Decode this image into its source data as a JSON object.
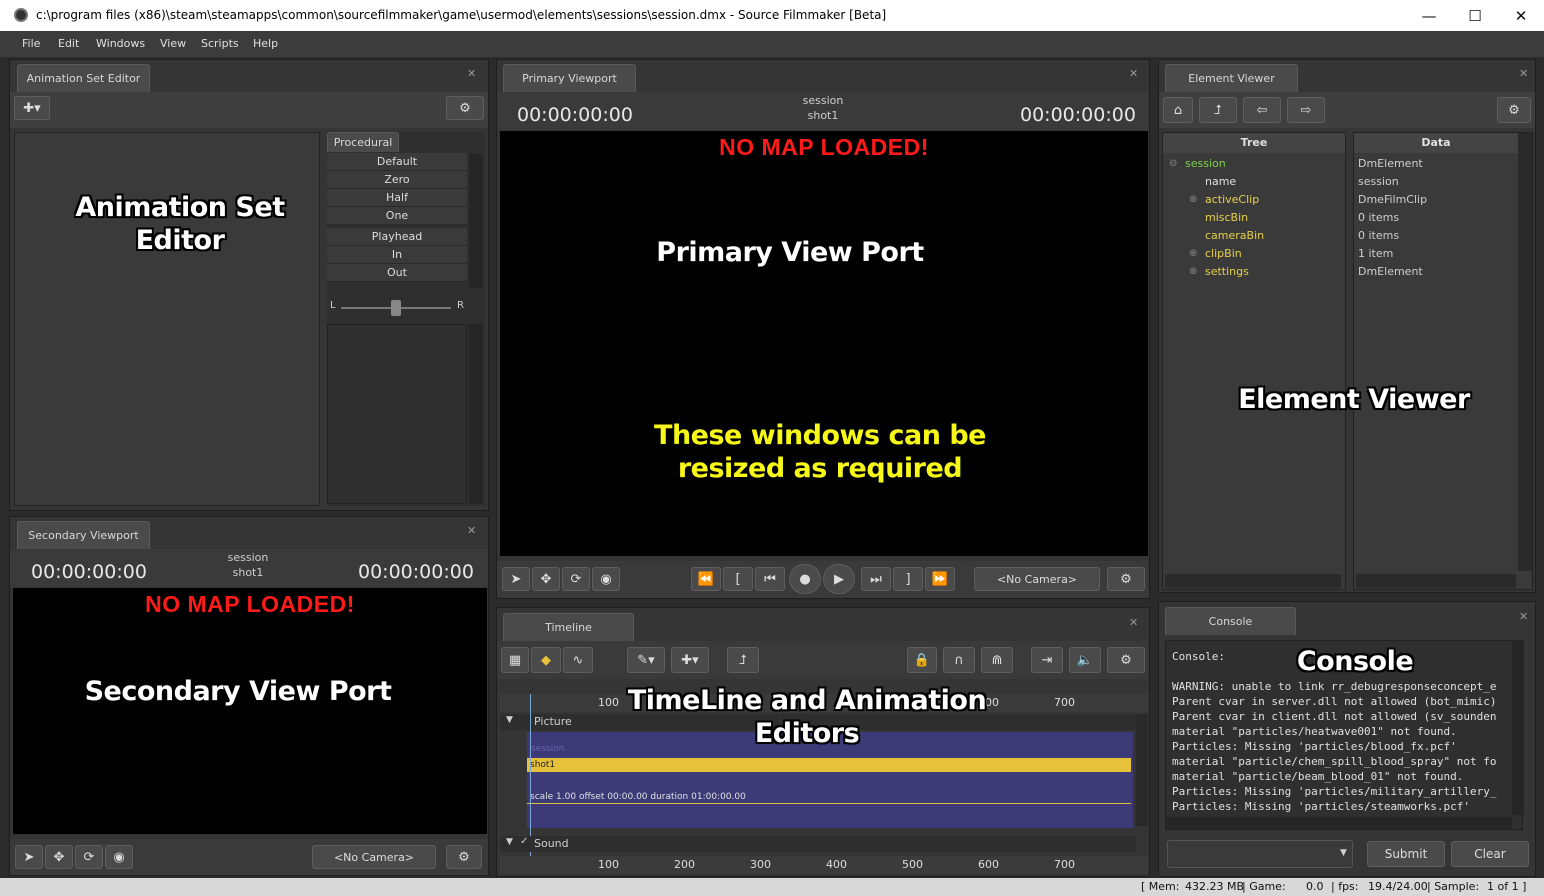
{
  "window": {
    "title": "c:\\program files (x86)\\steam\\steamapps\\common\\sourcefilmmaker\\game\\usermod\\elements\\sessions\\session.dmx - Source Filmmaker [Beta]",
    "minimize": "—",
    "maximize": "☐",
    "close": "✕"
  },
  "menu": [
    "File",
    "Edit",
    "Windows",
    "View",
    "Scripts",
    "Help"
  ],
  "anim_set_editor": {
    "tab": "Animation Set Editor",
    "overlay": [
      "Animation Set",
      "Editor"
    ],
    "procedural_tab": "Procedural",
    "procedural_items": [
      "Default",
      "Zero",
      "Half",
      "One",
      "Playhead",
      "In",
      "Out"
    ],
    "slider_left": "L",
    "slider_right": "R"
  },
  "secondary_viewport": {
    "tab": "Secondary Viewport",
    "session": "session",
    "shot": "shot1",
    "time_left": "00:00:00:00",
    "time_right": "00:00:00:00",
    "no_map": "NO MAP LOADED!",
    "overlay": "Secondary View Port",
    "camera": "<No Camera>"
  },
  "primary_viewport": {
    "tab": "Primary Viewport",
    "session": "session",
    "shot": "shot1",
    "time_left": "00:00:00:00",
    "time_right": "00:00:00:00",
    "no_map": "NO MAP LOADED!",
    "overlay": "Primary View Port",
    "overlay_note": [
      "These windows can be",
      "resized as required"
    ],
    "camera": "<No Camera>"
  },
  "element_viewer": {
    "tab": "Element Viewer",
    "col_tree": "Tree",
    "col_data": "Data",
    "overlay": "Element Viewer",
    "rows": [
      {
        "name": "session",
        "data": "DmElement",
        "color": "#7fd04a",
        "expand": "⊖"
      },
      {
        "name": "name",
        "data": "session",
        "color": "#e0e0e0",
        "expand": ""
      },
      {
        "name": "activeClip",
        "data": "DmeFilmClip",
        "color": "#e6d24a",
        "expand": "⊕"
      },
      {
        "name": "miscBin",
        "data": "0 items",
        "color": "#e6d24a",
        "expand": ""
      },
      {
        "name": "cameraBin",
        "data": "0 items",
        "color": "#e6d24a",
        "expand": ""
      },
      {
        "name": "clipBin",
        "data": "1 item",
        "color": "#e6d24a",
        "expand": "⊕"
      },
      {
        "name": "settings",
        "data": "DmElement",
        "color": "#e6d24a",
        "expand": "⊕"
      }
    ]
  },
  "timeline": {
    "tab": "Timeline",
    "overlay": [
      "TimeLine and Animation",
      "Editors"
    ],
    "ruler_ticks": [
      "100",
      "600",
      "700"
    ],
    "ruler_ticks_bottom": [
      "100",
      "200",
      "300",
      "400",
      "500",
      "600",
      "700"
    ],
    "track_picture": "Picture",
    "track_sound": "Sound",
    "clip_session": "session",
    "clip_shot": "shot1",
    "clip_info": "scale 1.00 offset  00:00.00 duration  01:00:00.00"
  },
  "console": {
    "tab": "Console",
    "overlay": "Console",
    "header": "Console:",
    "lines": [
      "WARNING: unable to link rr_debugresponseconcept_e",
      "Parent cvar in server.dll not allowed (bot_mimic)",
      "Parent cvar in client.dll not allowed (sv_sounden",
      "material \"particles/heatwave001\" not found.",
      "Particles: Missing 'particles/blood_fx.pcf'",
      "material \"particle/chem_spill_blood_spray\" not fo",
      "material \"particle/beam_blood_01\" not found.",
      "Particles: Missing 'particles/military_artillery_",
      "Particles: Missing 'particles/steamworks.pcf'"
    ],
    "submit": "Submit",
    "clear": "Clear"
  },
  "status": {
    "mem_label": "[ Mem:",
    "mem_value": "432.23 MB",
    "game_label": "| Game:",
    "game_value": "0.0",
    "fps_label": "| fps:",
    "fps_value": "19.4/24.00",
    "sample_label": "| Sample:",
    "sample_value": "1 of 1 ]"
  },
  "colors": {
    "nomap": "#ff1a1a",
    "note": "#f7f718",
    "clip_shot": "#e8c13a",
    "clip_track": "#3d3a78"
  }
}
